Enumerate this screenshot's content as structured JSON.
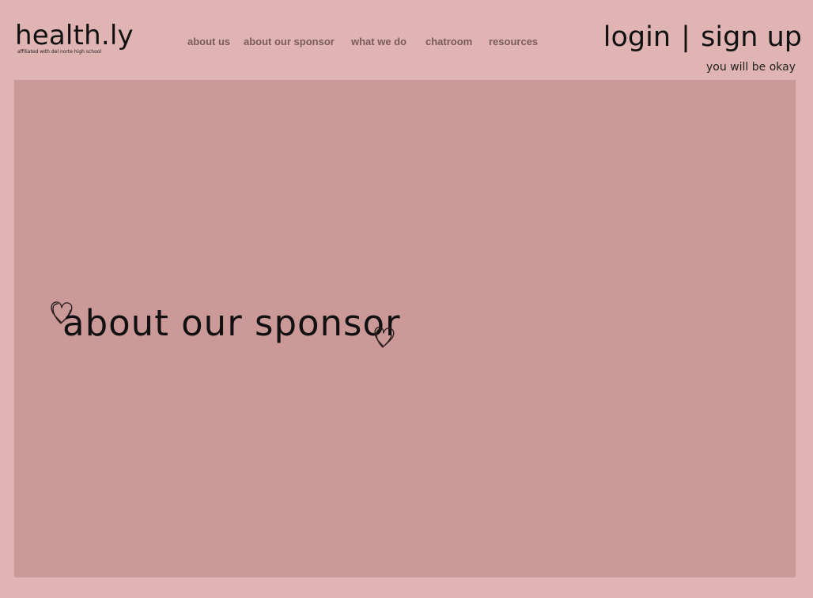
{
  "header": {
    "logo_title": "health.ly",
    "logo_subtitle": "affiliated with del norte high school",
    "nav": [
      {
        "label": "about us"
      },
      {
        "label": "about our sponsor"
      },
      {
        "label": "what we do"
      },
      {
        "label": "chatroom"
      },
      {
        "label": "resources"
      }
    ],
    "login_label": "login",
    "separator": "|",
    "signup_label": "sign up",
    "tagline": "you will be okay"
  },
  "hero": {
    "heading": "about our sponsor",
    "background_color": "#cb9a98",
    "decoration_icons": [
      "heart-outline-icon",
      "heart-outline-icon"
    ]
  },
  "colors": {
    "page_background": "#e1b4b4",
    "nav_text": "#7a5b5b",
    "text": "#111111"
  }
}
